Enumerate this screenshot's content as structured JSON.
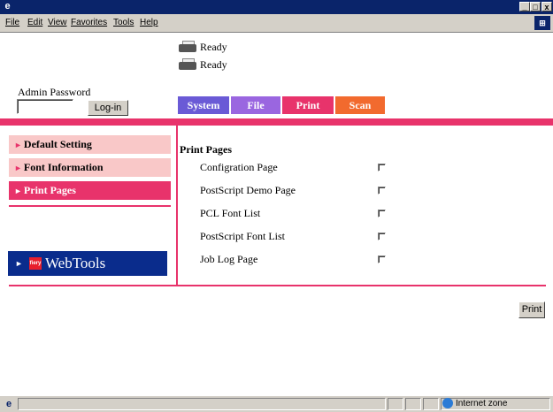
{
  "titlebar": {
    "app_icon": "ie-icon",
    "min": "_",
    "max": "□",
    "close": "x"
  },
  "menu": {
    "items": [
      "File",
      "Edit",
      "View",
      "Favorites",
      "Tools",
      "Help"
    ]
  },
  "throbber": {
    "icon": "windows-logo-icon",
    "glyph": "⊞"
  },
  "status": {
    "line1": "Ready",
    "line2": "Ready"
  },
  "admin": {
    "label": "Admin Password",
    "password_value": "",
    "login_label": "Log-in"
  },
  "tabs": [
    {
      "label": "System",
      "color": "#6a5ad6"
    },
    {
      "label": "File",
      "color": "#9a66e0"
    },
    {
      "label": "Print",
      "color": "#e8336b"
    },
    {
      "label": "Scan",
      "color": "#f26a2e"
    }
  ],
  "sidebar": {
    "items": [
      {
        "label": "Default Setting",
        "selected": false
      },
      {
        "label": "Font Information",
        "selected": false
      },
      {
        "label": "Print Pages",
        "selected": true
      }
    ],
    "webtools_label": "WebTools",
    "webtools_logo": "fiery",
    "colors": {
      "item_bg": "#f9c8c8",
      "selected_bg": "#e8336b",
      "arrow": "#e8336b"
    }
  },
  "print_pages": {
    "title": "Print Pages",
    "items": [
      {
        "label": "Configration Page",
        "checked": false
      },
      {
        "label": "PostScript Demo Page",
        "checked": false
      },
      {
        "label": "PCL Font List",
        "checked": false
      },
      {
        "label": "PostScript Font List",
        "checked": false
      },
      {
        "label": "Job Log Page",
        "checked": false
      }
    ],
    "print_label": "Print"
  },
  "statusbar": {
    "zone_label": "Internet zone"
  }
}
